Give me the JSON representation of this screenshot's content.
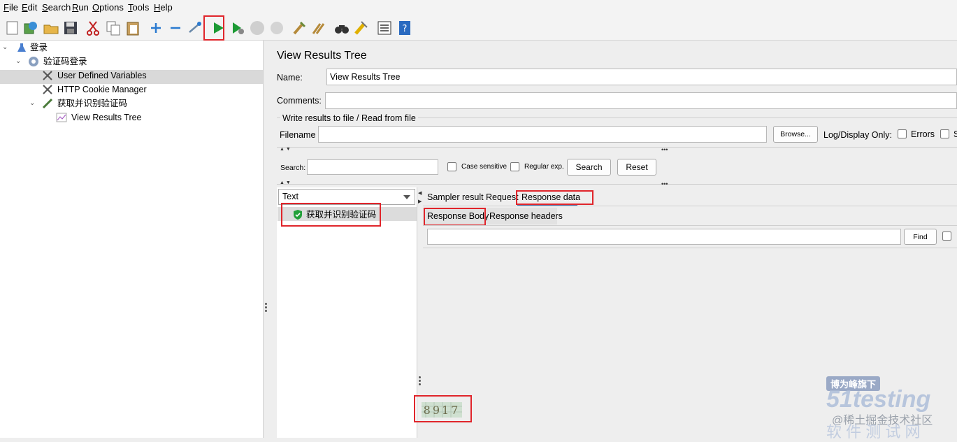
{
  "menu": [
    "File",
    "Edit",
    "Search",
    "Run",
    "Options",
    "Tools",
    "Help"
  ],
  "toolbar": {
    "icons": [
      "new-icon",
      "templates-icon",
      "open-icon",
      "save-icon",
      "cut-icon",
      "copy-icon",
      "paste-icon",
      "expand-icon",
      "collapse-icon",
      "toggle-icon",
      "start-icon",
      "start-no-pauses-icon",
      "stop-icon",
      "shutdown-icon",
      "clear-icon",
      "clear-all-icon",
      "search-icon",
      "reset-search-icon",
      "function-helper-icon",
      "help-icon"
    ]
  },
  "tree": {
    "items": [
      {
        "label": "登录",
        "icon": "test-plan-icon"
      },
      {
        "label": "验证码登录",
        "icon": "thread-group-icon"
      },
      {
        "label": "User Defined Variables",
        "icon": "config-element-icon"
      },
      {
        "label": "HTTP Cookie Manager",
        "icon": "config-element-icon"
      },
      {
        "label": "获取并识别验证码",
        "icon": "sampler-icon"
      },
      {
        "label": "View Results Tree",
        "icon": "listener-icon"
      }
    ]
  },
  "panel": {
    "title": "View Results Tree",
    "name_label": "Name:",
    "name_value": "View Results Tree",
    "comments_label": "Comments:",
    "file_section": "Write results to file / Read from file",
    "filename_label": "Filename",
    "browse": "Browse...",
    "log_display": "Log/Display Only:",
    "errors": "Errors",
    "successes_partial": "S"
  },
  "search": {
    "label": "Search:",
    "case_sensitive": "Case sensitive",
    "regex": "Regular exp.",
    "search_btn": "Search",
    "reset_btn": "Reset"
  },
  "results": {
    "renderer": "Text",
    "items": [
      {
        "label": "获取并识别验证码",
        "status": "success"
      }
    ]
  },
  "tabs": [
    "Sampler result",
    "Request",
    "Response data"
  ],
  "subtabs": [
    "Response Body",
    "Response headers"
  ],
  "find_btn": "Find",
  "response_image_text": "8917",
  "watermarks": {
    "w1": "博为峰旗下",
    "w2": "51testing",
    "w3": "@稀土掘金技术社区",
    "w4": "软 件 测 试 网"
  }
}
